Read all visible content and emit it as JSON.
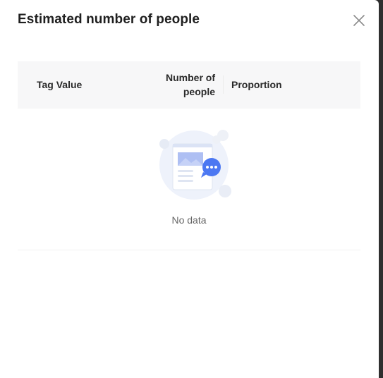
{
  "dialog": {
    "title": "Estimated number of people",
    "close_icon": "close-icon"
  },
  "table": {
    "columns": [
      "Tag Value",
      "Number of people",
      "Proportion"
    ],
    "rows": [],
    "empty_text": "No data",
    "empty_icon": "empty-document-chat-icon"
  }
}
